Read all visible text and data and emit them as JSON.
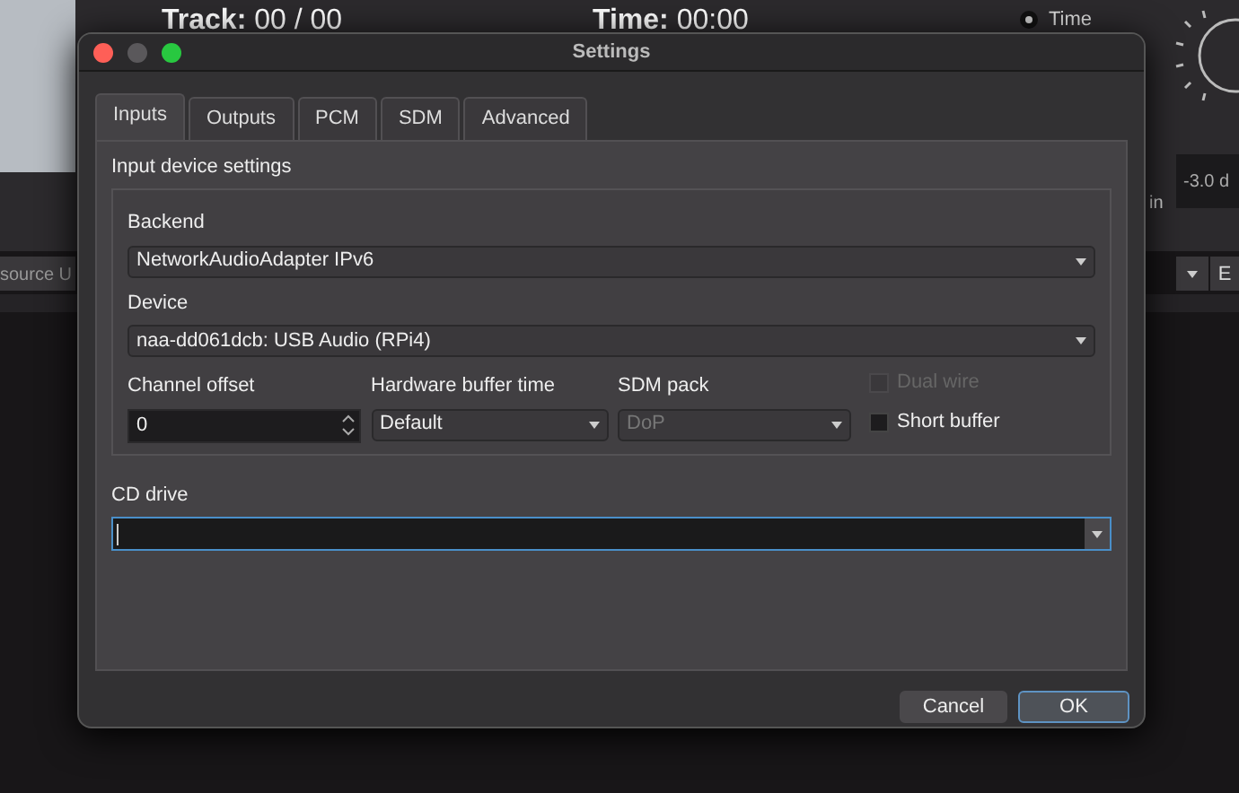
{
  "background": {
    "track": "**Track:** 00 / 00",
    "time": "**Time:** 00:00",
    "time_option": {
      "label": "Time",
      "selected": true
    },
    "level_reading": "-3.0 d",
    "side_label": "in",
    "source_field": "source U",
    "side_button": "E"
  },
  "window": {
    "title": "Settings"
  },
  "tabs": [
    {
      "label": "Inputs",
      "selected": true
    },
    {
      "label": "Outputs",
      "selected": false
    },
    {
      "label": "PCM",
      "selected": false
    },
    {
      "label": "SDM",
      "selected": false
    },
    {
      "label": "Advanced",
      "selected": false
    }
  ],
  "group": {
    "title": "Input device settings",
    "backend": {
      "label": "Backend",
      "value": "NetworkAudioAdapter IPv6"
    },
    "device": {
      "label": "Device",
      "value": "naa-dd061dcb: USB Audio (RPi4)"
    },
    "channel_offset": {
      "label": "Channel offset",
      "value": "0"
    },
    "buffer_time": {
      "label": "Hardware buffer time",
      "value": "Default"
    },
    "sdm_pack": {
      "label": "SDM pack",
      "value": "DoP",
      "disabled": true
    },
    "checks": [
      {
        "label": "Dual wire",
        "checked": false,
        "disabled": true
      },
      {
        "label": "Short buffer",
        "checked": false,
        "disabled": false
      }
    ]
  },
  "cd_drive": {
    "label": "CD drive"
  },
  "buttons": [
    {
      "label": "Cancel",
      "kind": "secondary"
    },
    {
      "label": "OK",
      "kind": "default"
    }
  ]
}
